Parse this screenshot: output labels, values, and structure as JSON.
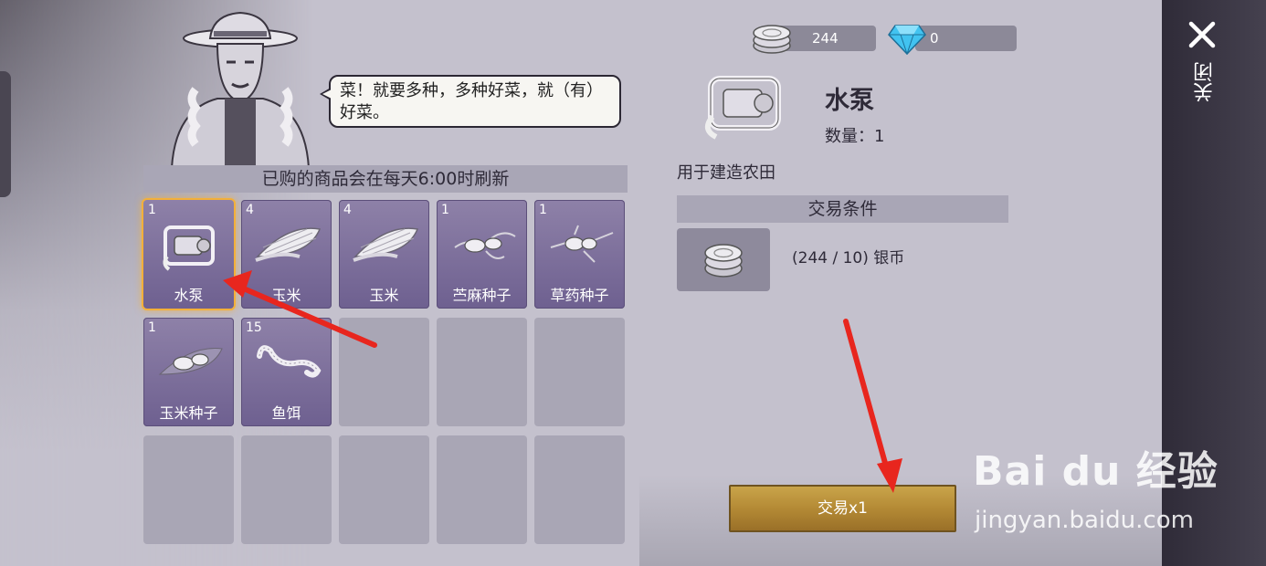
{
  "currency": {
    "silver": {
      "icon": "silver-coin-icon",
      "value": "244"
    },
    "gems": {
      "icon": "diamond-icon",
      "value": "0"
    }
  },
  "npc": {
    "dialog": "菜！就要多种，多种好菜，就（有）好菜。"
  },
  "shop": {
    "refresh_notice": "已购的商品会在每天6:00时刷新",
    "items": [
      {
        "qty": "1",
        "name": "水泵",
        "icon": "water-pump-icon",
        "selected": true
      },
      {
        "qty": "4",
        "name": "玉米",
        "icon": "corn-icon"
      },
      {
        "qty": "4",
        "name": "玉米",
        "icon": "corn-icon"
      },
      {
        "qty": "1",
        "name": "苎麻种子",
        "icon": "seed-icon"
      },
      {
        "qty": "1",
        "name": "草药种子",
        "icon": "seed-icon"
      },
      {
        "qty": "1",
        "name": "玉米种子",
        "icon": "corn-seed-icon"
      },
      {
        "qty": "15",
        "name": "鱼饵",
        "icon": "worm-bait-icon"
      }
    ]
  },
  "detail": {
    "title": "水泵",
    "quantity_label": "数量：1",
    "description": "用于建造农田",
    "conditions_header": "交易条件",
    "cost_text": "(244 / 10) 银币",
    "cost_icon": "silver-coin-icon"
  },
  "actions": {
    "trade_label": "交易x1",
    "close_label": "关闭"
  },
  "watermark": {
    "logo": "Bai du 经验",
    "url": "jingyan.baidu.com"
  },
  "colors": {
    "selected_border": "#f3b03a",
    "item_bg": "#7e7099",
    "trade_button": "#b48a35",
    "annotation_arrow": "#e8261e"
  }
}
